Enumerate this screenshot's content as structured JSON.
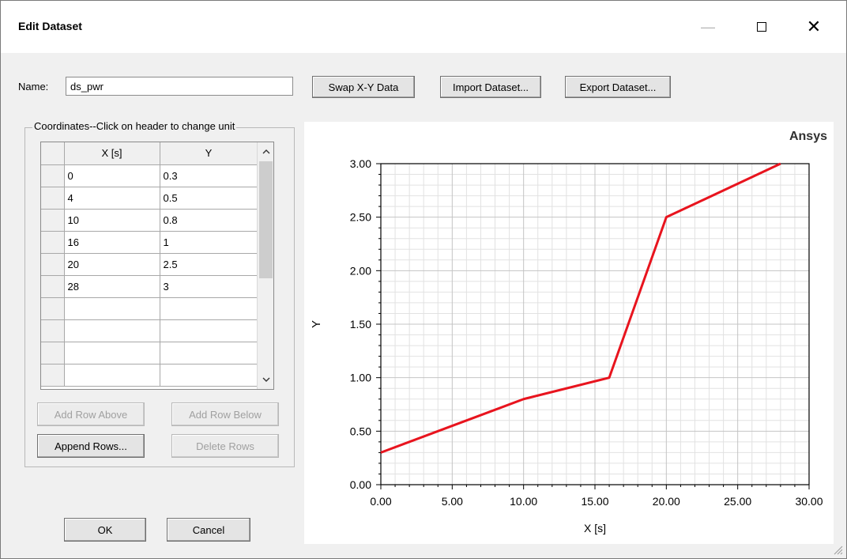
{
  "window": {
    "title": "Edit Dataset",
    "minimize_glyph": "—",
    "close_glyph": "✕"
  },
  "name": {
    "label": "Name:",
    "value": "ds_pwr"
  },
  "toolbar": {
    "swap": "Swap X-Y Data",
    "import": "Import Dataset...",
    "export": "Export Dataset..."
  },
  "coords": {
    "legend": "Coordinates--Click on header to change unit",
    "headers": [
      "X [s]",
      "Y"
    ],
    "rows": [
      [
        "0",
        "0.3"
      ],
      [
        "4",
        "0.5"
      ],
      [
        "10",
        "0.8"
      ],
      [
        "16",
        "1"
      ],
      [
        "20",
        "2.5"
      ],
      [
        "28",
        "3"
      ],
      [
        "",
        ""
      ],
      [
        "",
        ""
      ],
      [
        "",
        ""
      ],
      [
        "",
        ""
      ]
    ],
    "scroll_up": "^",
    "scroll_down": "v"
  },
  "row_buttons": {
    "add_above": "Add Row Above",
    "add_below": "Add Row Below",
    "append": "Append Rows...",
    "delete": "Delete Rows"
  },
  "footer": {
    "ok": "OK",
    "cancel": "Cancel"
  },
  "brand": "Ansys",
  "chart_data": {
    "type": "line",
    "xlabel": "X [s]",
    "ylabel": "Y",
    "xlim": [
      0,
      30
    ],
    "ylim": [
      0,
      3
    ],
    "xticks": [
      "0.00",
      "5.00",
      "10.00",
      "15.00",
      "20.00",
      "25.00",
      "30.00"
    ],
    "yticks": [
      "0.00",
      "0.50",
      "1.00",
      "1.50",
      "2.00",
      "2.50",
      "3.00"
    ],
    "grid": true,
    "series": [
      {
        "x": [
          0,
          4,
          10,
          16,
          20,
          28
        ],
        "y": [
          0.3,
          0.5,
          0.8,
          1,
          2.5,
          3
        ],
        "color": "#e8141e"
      }
    ]
  }
}
